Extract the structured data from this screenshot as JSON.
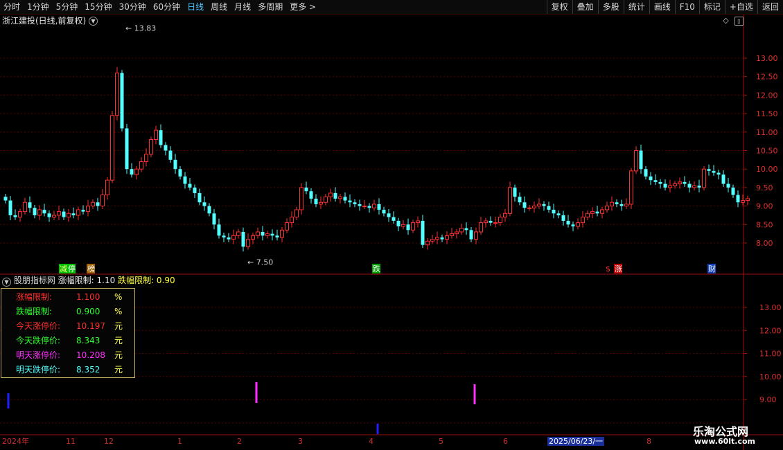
{
  "toolbar": {
    "period_tabs": [
      "分时",
      "1分钟",
      "5分钟",
      "15分钟",
      "30分钟",
      "60分钟",
      "日线",
      "周线",
      "月线",
      "多周期",
      "更多 >"
    ],
    "active_tab": "日线",
    "buttons": [
      "复权",
      "叠加",
      "多股",
      "统计",
      "画线",
      "F10",
      "标记",
      "+自选",
      "返回"
    ]
  },
  "stock_title": "浙江建投(日线,前复权)",
  "colors": {
    "up": "#ff3030",
    "down": "#54ffff",
    "grid": "#5a0000",
    "axis": "#a01010"
  },
  "price_axis": {
    "ticks": [
      8.0,
      8.5,
      9.0,
      9.5,
      10.0,
      10.5,
      11.0,
      11.5,
      12.0,
      12.5,
      13.0
    ],
    "labels": [
      "8.00",
      "8.50",
      "9.00",
      "9.50",
      "10.00",
      "10.50",
      "11.00",
      "11.50",
      "12.00",
      "12.50",
      "13.00"
    ]
  },
  "annotations": {
    "high": "13.83",
    "low": "7.50"
  },
  "event_tags": [
    {
      "text": "减",
      "color": "#00c000",
      "fg": "#ffff80"
    },
    {
      "text": "停",
      "color": "#00c000",
      "fg": "#ffffff"
    },
    {
      "text": "榜",
      "color": "#a06000",
      "fg": "#ffffff"
    },
    {
      "text": "跌",
      "color": "#00a000",
      "fg": "#ffffff"
    },
    {
      "text": "$",
      "color": "#000000",
      "fg": "#ff3030"
    },
    {
      "text": "涨",
      "color": "#c00000",
      "fg": "#ffffff"
    },
    {
      "text": "财",
      "color": "#1040c0",
      "fg": "#ffffff"
    }
  ],
  "indicator": {
    "name": "股朋指标网",
    "up_limit_label": "涨幅限制: 1.10",
    "down_limit_label": "跌幅限制: 0.90",
    "axis_labels": [
      "9.00",
      "10.00",
      "11.00",
      "12.00",
      "13.00"
    ],
    "axis_ticks": [
      9,
      10,
      11,
      12,
      13
    ]
  },
  "info_panel": [
    {
      "label": "涨幅限制:",
      "value": "1.100",
      "unit": "%",
      "color": "#ff3030"
    },
    {
      "label": "跌幅限制:",
      "value": "0.900",
      "unit": "%",
      "color": "#30ff30"
    },
    {
      "label": "今天涨停价:",
      "value": "10.197",
      "unit": "元",
      "color": "#ff3030"
    },
    {
      "label": "今天跌停价:",
      "value": "8.343",
      "unit": "元",
      "color": "#30ff30"
    },
    {
      "label": "明天涨停价:",
      "value": "10.208",
      "unit": "元",
      "color": "#ff30ff"
    },
    {
      "label": "明天跌停价:",
      "value": "8.352",
      "unit": "元",
      "color": "#54ffff"
    }
  ],
  "time_axis": {
    "labels": [
      "2024年",
      "11",
      "12",
      "1",
      "2",
      "3",
      "4",
      "5",
      "6",
      "8"
    ],
    "date_badge": "2025/06/23/一"
  },
  "watermark": {
    "title": "乐淘公式网",
    "url": "www.60lt.com"
  },
  "chart_data": {
    "type": "candlestick",
    "ylim": [
      7.2,
      14.0
    ],
    "closes": [
      9.15,
      8.75,
      8.7,
      8.85,
      9.1,
      8.95,
      8.75,
      8.9,
      8.8,
      8.7,
      8.75,
      8.85,
      8.7,
      8.8,
      8.75,
      8.9,
      8.85,
      9.0,
      9.1,
      9.0,
      9.3,
      9.7,
      11.45,
      12.6,
      11.1,
      10.0,
      9.85,
      10.0,
      10.2,
      10.4,
      10.8,
      11.05,
      10.65,
      10.5,
      10.25,
      10.0,
      9.8,
      9.6,
      9.5,
      9.35,
      9.1,
      9.0,
      8.8,
      8.5,
      8.2,
      8.15,
      8.1,
      8.2,
      8.3,
      7.9,
      8.1,
      8.2,
      8.3,
      8.2,
      8.25,
      8.2,
      8.15,
      8.35,
      8.55,
      8.7,
      8.9,
      9.5,
      9.4,
      9.2,
      9.05,
      9.1,
      9.25,
      9.35,
      9.2,
      9.25,
      9.15,
      9.1,
      9.05,
      9.0,
      9.0,
      8.95,
      9.05,
      8.9,
      8.8,
      8.7,
      8.6,
      8.45,
      8.5,
      8.35,
      8.55,
      8.6,
      7.95,
      8.05,
      8.1,
      8.15,
      8.1,
      8.2,
      8.25,
      8.3,
      8.4,
      8.35,
      8.1,
      8.3,
      8.55,
      8.6,
      8.55,
      8.55,
      8.7,
      8.8,
      9.5,
      9.25,
      9.1,
      8.95,
      8.95,
      9.0,
      9.05,
      9.0,
      8.9,
      8.8,
      8.75,
      8.6,
      8.5,
      8.45,
      8.55,
      8.7,
      8.8,
      8.85,
      8.8,
      8.9,
      9.0,
      9.1,
      9.05,
      9.0,
      9.05,
      9.95,
      10.5,
      10.0,
      9.8,
      9.7,
      9.65,
      9.6,
      9.5,
      9.55,
      9.6,
      9.65,
      9.6,
      9.5,
      9.55,
      9.5,
      10.0,
      9.95,
      9.9,
      9.85,
      9.6,
      9.5,
      9.3,
      9.1,
      9.15,
      9.2
    ]
  }
}
